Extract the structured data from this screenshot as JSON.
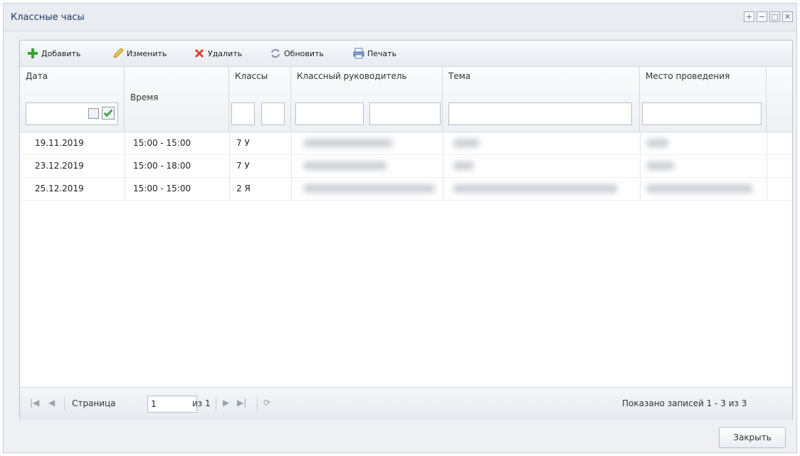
{
  "window": {
    "title": "Классные часы",
    "controls": [
      "+",
      "−",
      "□",
      "✕"
    ]
  },
  "toolbar": {
    "add_label": "Добавить",
    "edit_label": "Изменить",
    "delete_label": "Удалить",
    "refresh_label": "Обновить",
    "print_label": "Печать"
  },
  "grid": {
    "headers": {
      "date": "Дата",
      "time": "Время",
      "classes": "Классы",
      "teacher": "Классный руководитель",
      "topic": "Тема",
      "place": "Место проведения"
    },
    "rows": [
      {
        "date": "19.11.2019",
        "time": "15:00 - 15:00",
        "class": "7 У"
      },
      {
        "date": "23.12.2019",
        "time": "15:00 - 18:00",
        "class": "7 У"
      },
      {
        "date": "25.12.2019",
        "time": "15:00 - 15:00",
        "class": "2 Я"
      }
    ]
  },
  "pager": {
    "page_label": "Страница",
    "page_value": "1",
    "of_label": "из 1",
    "summary": "Показано записей 1 - 3 из 3"
  },
  "footer": {
    "close_label": "Закрыть"
  },
  "colors": {
    "title_text": "#1e3a63",
    "add_icon": "#3aa43a",
    "delete_icon": "#e03a2a",
    "edit_icon": "#d9b62a"
  }
}
